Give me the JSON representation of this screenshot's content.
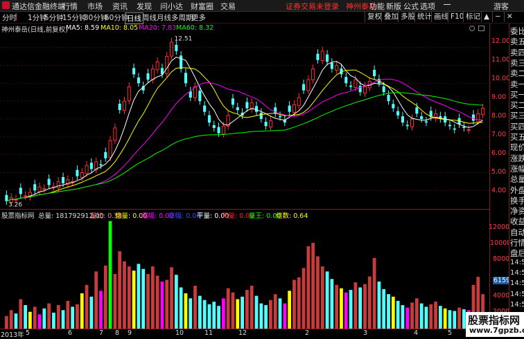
{
  "titlebar": {
    "app_name": "通达信金融终端",
    "menus": [
      "行情",
      "市场",
      "资讯",
      "发现",
      "问小达",
      "财富圈",
      "交易"
    ],
    "warning": "证券交易未登录",
    "stock_link": "神州泰岳",
    "right_menus": [
      "功能",
      "新版",
      "公式",
      "选项"
    ],
    "user": "游客"
  },
  "toolbar": {
    "periods": [
      "分时",
      "1分钟",
      "5分钟",
      "15分钟",
      "30分钟",
      "60分钟",
      "日线",
      "周线",
      "月线",
      "多周期",
      "更多"
    ],
    "active_period": "日线",
    "buttons": [
      "复权",
      "叠加",
      "多股",
      "统计",
      "画线",
      "F10",
      "标记"
    ]
  },
  "main_chart": {
    "title": "神州泰岳(日线,前复权)",
    "ma": [
      {
        "label": "MA5: 8.59",
        "color": "#ffffff"
      },
      {
        "label": "MA10: 8.05",
        "color": "#ffff00"
      },
      {
        "label": "MA20: 7.83",
        "color": "#ff00ff"
      },
      {
        "label": "MA60: 8.32",
        "color": "#00ff00"
      }
    ],
    "price_ticks": [
      "12.00",
      "11.00",
      "10.00",
      "9.00",
      "8.00",
      "7.00",
      "6.00",
      "5.00",
      "4.00"
    ],
    "high_label": "12.51",
    "low_label": "3.26"
  },
  "vol_panel": {
    "indicator_name": "股票指标网",
    "total": "总量: 181792912.00",
    "items": [
      {
        "label": "量比: 0.38",
        "color": "#ff8080"
      },
      {
        "label": "倍量: 0.00",
        "color": "#ffff00"
      },
      {
        "label": "缩幅: 0.00",
        "color": "#ff00ff"
      },
      {
        "label": "涨幅: 0.00",
        "color": "#4040ff"
      },
      {
        "label": "平量: 0.00",
        "color": "#ffffff"
      },
      {
        "label": "天量: 0.00",
        "color": "#ff2020"
      },
      {
        "label": "量王: 0.00",
        "color": "#00ff00"
      },
      {
        "label": "倍数: 0.64",
        "color": "#ffff00"
      }
    ],
    "vol_ticks": [
      "12000",
      "10000",
      "8000",
      "6000",
      "4000",
      "2000"
    ],
    "current_tag": "6159"
  },
  "right_panel": {
    "items": [
      "委比",
      "卖五",
      "卖四",
      "卖三",
      "卖二",
      "卖一",
      "买一",
      "买二",
      "买三",
      "买四",
      "买五",
      "现价",
      "涨跌",
      "涨幅",
      "总量",
      "外盘",
      "换手",
      "净资",
      "收益",
      "自动",
      "行情",
      "盘后",
      "14:50",
      "14:50",
      "14:50",
      "14:50",
      "14:50",
      "14:50",
      "14:50"
    ]
  },
  "date_axis": {
    "labels": [
      "2013年",
      "5",
      "6",
      "7",
      "8",
      "9",
      "10",
      "11",
      "12",
      "2",
      "3",
      "4",
      "5"
    ]
  },
  "watermark": {
    "title": "股票指标网",
    "url": "www.7gpzb.com"
  },
  "colors": {
    "up": "#ff3030",
    "down": "#54ffff",
    "border": "#8b1a1a"
  },
  "chart_data": {
    "type": "candlestick+volume",
    "title": "神州泰岳(日线,前复权)",
    "x_labels": [
      "2013年",
      "5",
      "6",
      "7",
      "8",
      "9",
      "10",
      "11",
      "12",
      "2",
      "3",
      "4",
      "5"
    ],
    "price_ylim": [
      3.2,
      12.8
    ],
    "price_high": 12.51,
    "price_low": 3.26,
    "close_series": [
      3.4,
      3.6,
      3.5,
      3.8,
      3.7,
      3.9,
      4.0,
      4.2,
      4.1,
      4.3,
      4.2,
      4.5,
      4.4,
      4.6,
      4.5,
      4.8,
      5.0,
      5.4,
      5.2,
      5.6,
      5.4,
      5.8,
      6.8,
      7.5,
      8.5,
      9.0,
      9.8,
      10.5,
      10.0,
      9.6,
      10.2,
      10.8,
      11.2,
      10.5,
      11.5,
      12.3,
      11.8,
      10.8,
      10.0,
      9.2,
      9.8,
      9.0,
      8.4,
      7.8,
      7.5,
      7.2,
      7.6,
      8.2,
      8.8,
      8.5,
      8.2,
      8.6,
      8.9,
      8.4,
      8.0,
      7.6,
      7.9,
      8.3,
      8.1,
      7.8,
      8.4,
      8.8,
      9.2,
      9.6,
      10.2,
      10.8,
      11.3,
      11.8,
      11.2,
      10.8,
      11.0,
      10.5,
      10.0,
      9.8,
      10.2,
      9.5,
      9.8,
      10.1,
      10.4,
      10.0,
      9.5,
      9.0,
      8.6,
      8.2,
      7.8,
      7.6,
      8.0,
      8.3,
      8.0,
      7.8,
      8.1,
      8.3,
      8.0,
      7.8,
      7.6,
      7.4,
      7.7,
      7.5,
      7.4,
      7.9,
      8.3,
      8.6
    ],
    "ma_values": {
      "MA5": 8.59,
      "MA10": 8.05,
      "MA20": 7.83,
      "MA60": 8.32
    },
    "vol_ylim": [
      0,
      13000
    ],
    "volume_series": [
      1500,
      2200,
      1800,
      3500,
      2800,
      2000,
      2600,
      1700,
      2400,
      3000,
      1900,
      2800,
      2200,
      3300,
      2600,
      2900,
      4200,
      5200,
      3800,
      6800,
      4500,
      7500,
      12800,
      6500,
      9200,
      8000,
      7400,
      6900,
      7700,
      7100,
      6500,
      7400,
      6300,
      5600,
      5800,
      7300,
      6400,
      4900,
      4200,
      3600,
      5100,
      3900,
      3400,
      2900,
      3200,
      2700,
      3600,
      4800,
      4300,
      3500,
      3800,
      4600,
      5100,
      3900,
      3000,
      2800,
      3400,
      4100,
      3600,
      3000,
      4500,
      5800,
      6100,
      7200,
      9800,
      10200,
      8600,
      7400,
      6800,
      5900,
      5200,
      4800,
      4300,
      4600,
      5500,
      4900,
      5300,
      6200,
      8400,
      5600,
      4700,
      4100,
      3800,
      3300,
      2800,
      2500,
      3100,
      3600,
      3000,
      2600,
      2900,
      3200,
      2700,
      2400,
      2200,
      2100,
      2500,
      2300,
      2200,
      5200,
      6159,
      4100
    ]
  }
}
